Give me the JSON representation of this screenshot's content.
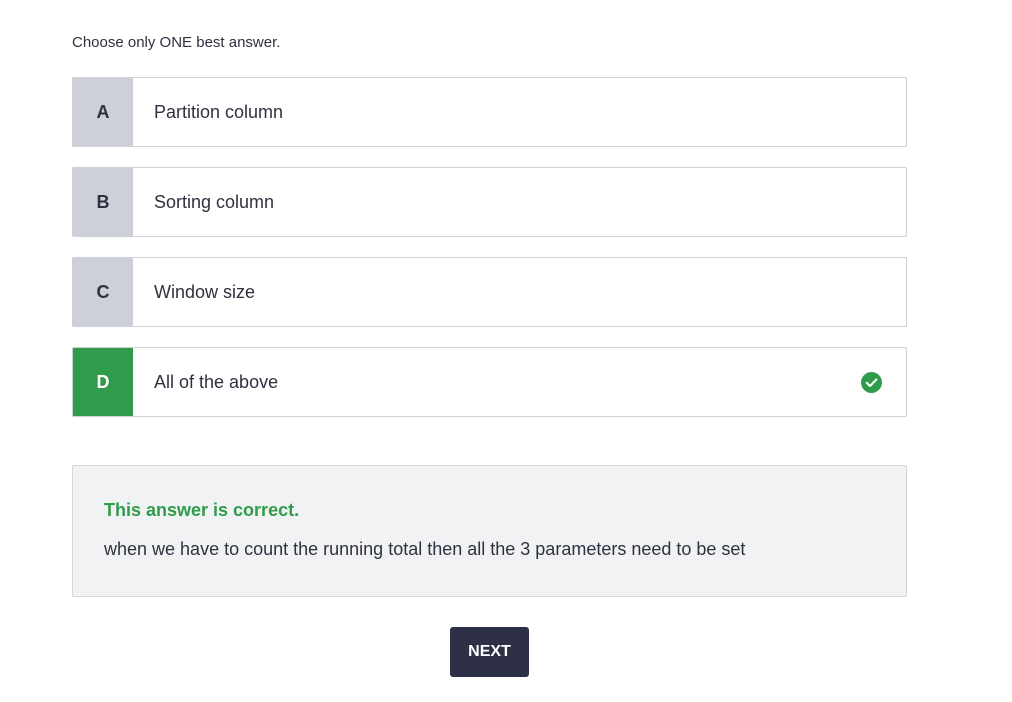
{
  "instruction": "Choose only ONE best answer.",
  "options": [
    {
      "letter": "A",
      "text": "Partition column",
      "correct": false
    },
    {
      "letter": "B",
      "text": "Sorting column",
      "correct": false
    },
    {
      "letter": "C",
      "text": "Window size",
      "correct": false
    },
    {
      "letter": "D",
      "text": "All of the above",
      "correct": true
    }
  ],
  "feedback": {
    "title": "This answer is correct.",
    "explanation": "when we have to count the running total then all the 3 parameters need to be set"
  },
  "next_button": {
    "label": "NEXT"
  },
  "colors": {
    "correct_green": "#2f9b4b",
    "letter_gray": "#cdd0d9",
    "button_dark": "#2e3047",
    "feedback_bg": "#f1f2f4"
  },
  "icons": {
    "correct_indicator": "check-circle-icon"
  }
}
